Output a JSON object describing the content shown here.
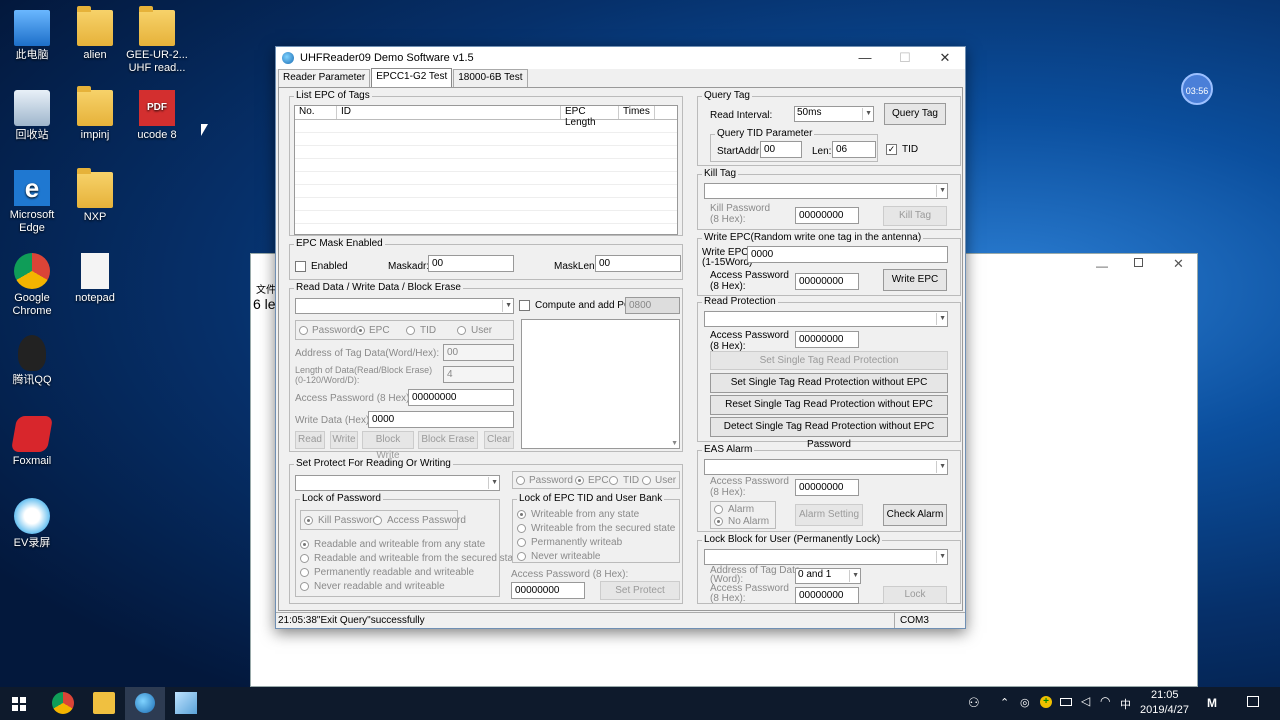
{
  "desktop": {
    "icons": [
      {
        "label": "此电脑"
      },
      {
        "label": "alien"
      },
      {
        "label": "GEE-UR-2... UHF read..."
      },
      {
        "label": "回收站"
      },
      {
        "label": "impinj"
      },
      {
        "label": "ucode 8"
      },
      {
        "label": "Microsoft Edge"
      },
      {
        "label": "NXP"
      },
      {
        "label": "Google Chrome"
      },
      {
        "label": "notepad"
      },
      {
        "label": "腾讯QQ"
      },
      {
        "label": "Foxmail"
      },
      {
        "label": "EV录屏"
      }
    ],
    "pdf_badge": "PDF",
    "bg_window_text": "文件",
    "bg_window_text2": "6 le",
    "clock_bubble": "03:56"
  },
  "app": {
    "title": "UHFReader09 Demo Software v1.5",
    "tabs": [
      "Reader Parameter",
      "EPCC1-G2 Test",
      "18000-6B Test"
    ],
    "list": {
      "legend": "List EPC of Tags",
      "cols": [
        "No.",
        "ID",
        "EPC Length",
        "Times"
      ]
    },
    "mask": {
      "legend": "EPC Mask Enabled",
      "enabled": "Enabled",
      "maskadr": "Maskadr:",
      "maskadr_val": "00",
      "masklen": "MaskLen:",
      "masklen_val": "00"
    },
    "rw": {
      "legend": "Read Data / Write Data / Block Erase",
      "compute": "Compute and add PC:",
      "pc_val": "0800",
      "banks": [
        "Password",
        "EPC",
        "TID",
        "User"
      ],
      "addr": "Address of Tag Data(Word/Hex):",
      "addr_val": "00",
      "len": "Length of Data(Read/Block Erase)",
      "len2": "(0-120/Word/D):",
      "len_val": "4",
      "pwd": "Access Password (8 Hex):",
      "pwd_val": "00000000",
      "wdata": "Write Data (Hex):",
      "wdata_val": "0000",
      "buttons": [
        "Read",
        "Write",
        "Block Write",
        "Block Erase",
        "Clear"
      ]
    },
    "protect": {
      "legend": "Set Protect For Reading Or Writing",
      "banks": [
        "Password",
        "EPC",
        "TID",
        "User"
      ],
      "lockpwd": "Lock of Password",
      "kill": "Kill Password",
      "access": "Access Password",
      "opts": [
        "Readable and  writeable from any state",
        "Readable and writeable from the secured state",
        "Permanently readable and writeable",
        "Never readable and writeable"
      ],
      "lockepc": "Lock of EPC TID and User Bank",
      "opts2": [
        "Writeable from any state",
        "Writeable from the secured state",
        "Permanently writeab",
        "Never writeable"
      ],
      "pwd": "Access Password (8 Hex):",
      "pwd_val": "00000000",
      "btn": "Set Protect"
    },
    "query": {
      "legend": "Query Tag",
      "interval": "Read Interval:",
      "interval_val": "50ms",
      "btn": "Query Tag",
      "tid_legend": "Query TID Parameter",
      "start": "StartAddr:",
      "start_val": "00",
      "len": "Len:",
      "len_val": "06",
      "tid": "TID"
    },
    "kill": {
      "legend": "Kill Tag",
      "pwd": "Kill Password",
      "pwd2": "(8 Hex):",
      "pwd_val": "00000000",
      "btn": "Kill Tag"
    },
    "wepc": {
      "legend": "Write EPC(Random write one tag in the antenna)",
      "lbl": "Write EPC:",
      "lbl2": "(1-15Word)",
      "val": "0000",
      "pwd": "Access Password",
      "pwd2": "(8 Hex):",
      "pwd_val": "00000000",
      "btn": "Write EPC"
    },
    "rp": {
      "legend": "Read Protection",
      "pwd": "Access Password",
      "pwd2": "(8 Hex):",
      "pwd_val": "00000000",
      "buttons": [
        "Set Single Tag Read Protection",
        "Set Single Tag Read Protection without EPC",
        "Reset Single Tag Read Protection without EPC",
        "Detect Single Tag Read Protection without EPC Password"
      ]
    },
    "eas": {
      "legend": "EAS Alarm",
      "pwd": "Access Password",
      "pwd2": "(8 Hex):",
      "pwd_val": "00000000",
      "alarm": "Alarm",
      "noalarm": "No Alarm",
      "setting": "Alarm Setting",
      "check": "Check Alarm"
    },
    "lock": {
      "legend": "Lock Block for User (Permanently Lock)",
      "addr": "Address of Tag Data",
      "addr2": "(Word):",
      "addr_val": "0 and 1",
      "pwd": "Access Password",
      "pwd2": "(8 Hex):",
      "pwd_val": "00000000",
      "btn": "Lock"
    },
    "status": {
      "msg": "21:05:38\"Exit Query\"successfully",
      "port": "COM3"
    }
  },
  "taskbar": {
    "time": "21:05",
    "date": "2019/4/27",
    "ime": "中"
  }
}
